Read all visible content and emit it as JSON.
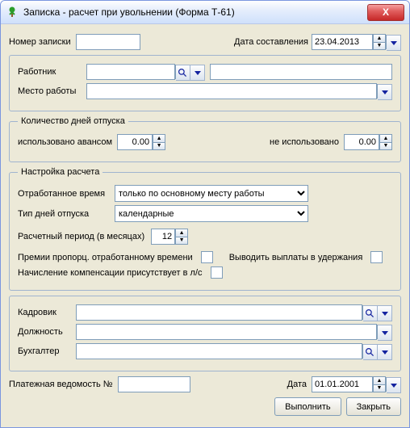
{
  "window": {
    "title": "Записка - расчет при увольнении (Форма Т-61)",
    "close": "X"
  },
  "top": {
    "record_no_label": "Номер записки",
    "record_no_value": "",
    "creation_date_label": "Дата составления",
    "creation_date_value": "23.04.2013"
  },
  "emp": {
    "worker_label": "Работник",
    "workplace_label": "Место работы"
  },
  "vacation_days": {
    "leg_": "Количество дней отпуска",
    "used_advance_label": "использовано авансом",
    "used_advance_value": "0.00",
    "unused_label": "не использовано",
    "unused_value": "0.00"
  },
  "calc": {
    "legend": "Настройка расчета",
    "worked_time_label": "Отработанное время",
    "worked_time_value": "только по основному месту работы",
    "day_type_label": "Тип дней отпуска",
    "day_type_value": "календарные",
    "period_label": "Расчетный период (в месяцах)",
    "period_value": "12",
    "bonus_label": "Премии пропорц. отработанному времени",
    "deductions_label": "Выводить выплаты в удержания",
    "comp_label": "Начисление компенсации присутствует в л/с"
  },
  "sign": {
    "kadrovik_label": "Кадровик",
    "position_label": "Должность",
    "accountant_label": "Бухгалтер"
  },
  "foot": {
    "payroll_label": "Платежная ведомость №",
    "payroll_value": "",
    "date_label": "Дата",
    "date_value": "01.01.2001",
    "exec": "Выполнить",
    "close": "Закрыть"
  }
}
